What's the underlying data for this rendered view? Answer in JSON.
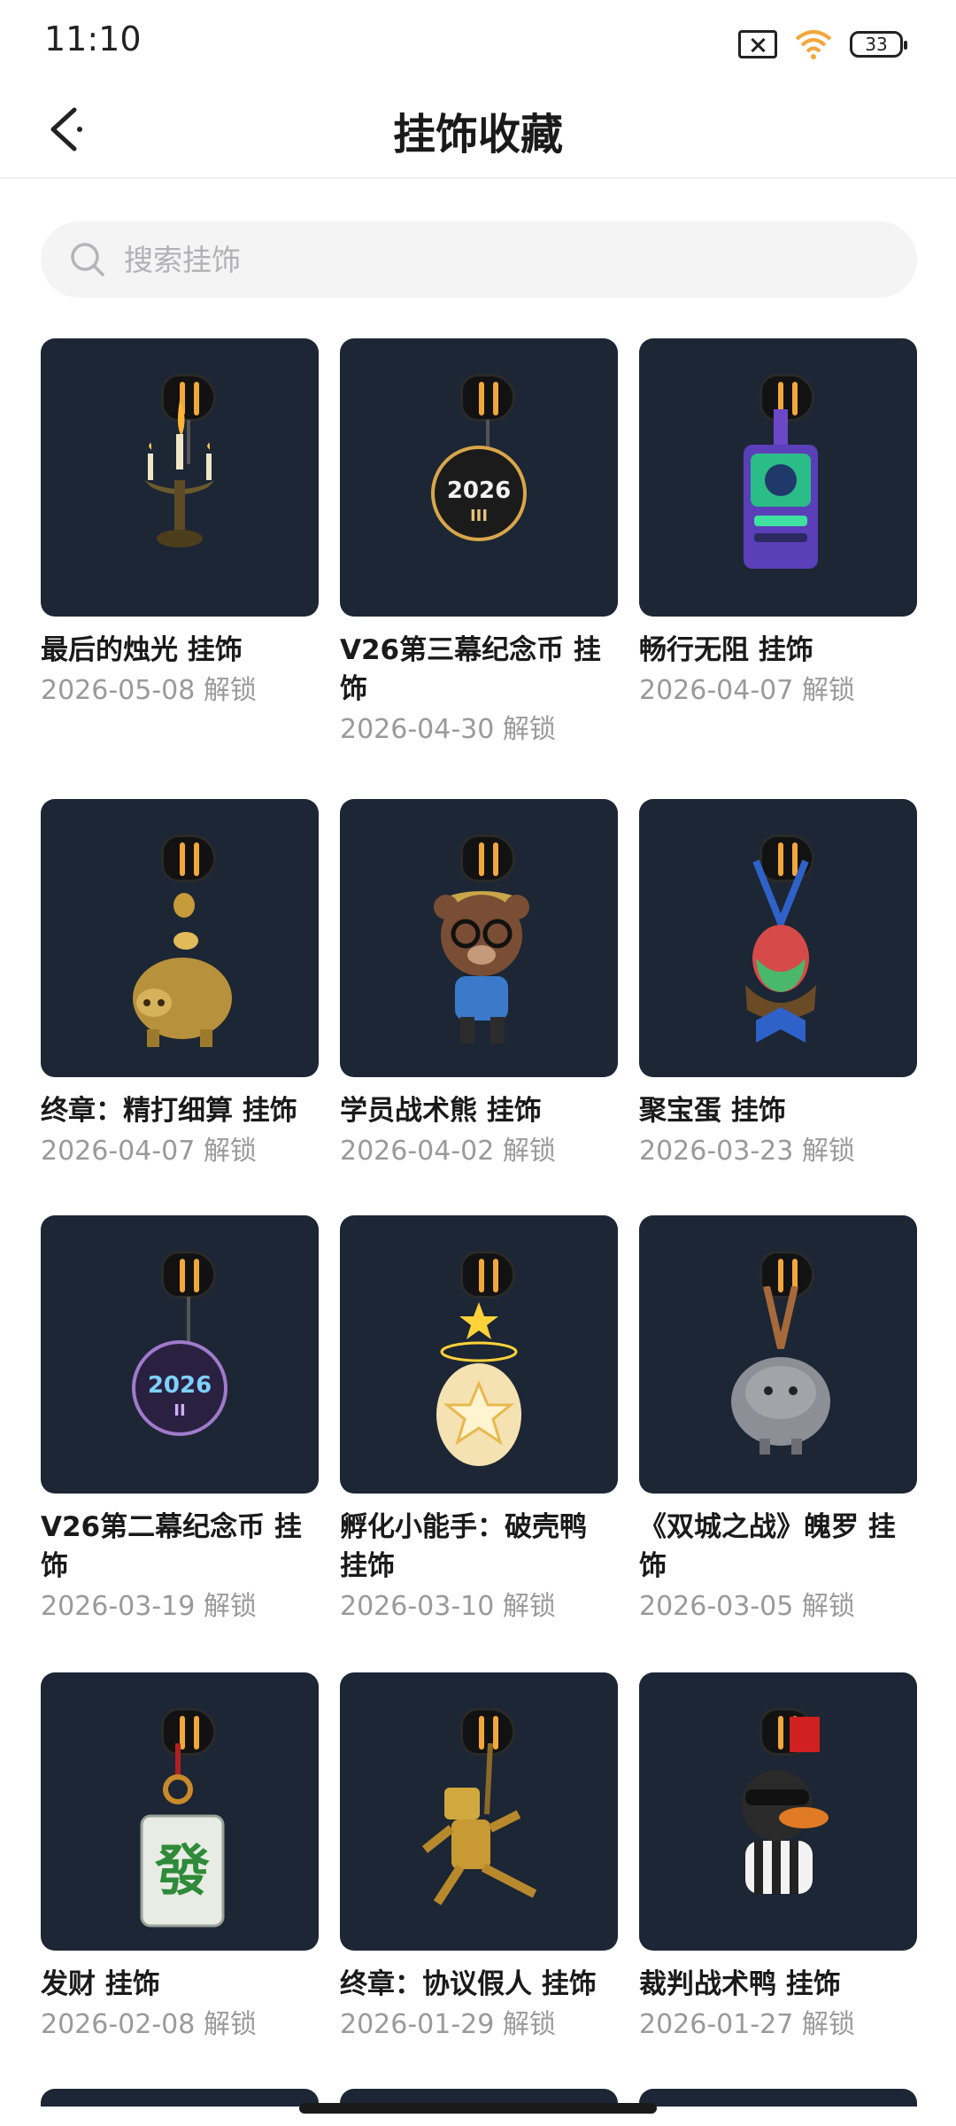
{
  "status_bar": {
    "time": "11:10",
    "battery": "33"
  },
  "header": {
    "title": "挂饰收藏"
  },
  "search": {
    "placeholder": "搜索挂饰",
    "value": ""
  },
  "items": [
    {
      "title": "最后的烛光 挂饰",
      "date": "2026-05-08 解锁",
      "icon": "candelabra-charm",
      "accent": "#c8a24a"
    },
    {
      "title": "V26第三幕纪念币 挂饰",
      "date": "2026-04-30 解锁",
      "icon": "coin-2026-iii-charm",
      "accent": "#1b1b1b"
    },
    {
      "title": "畅行无阻 挂饰",
      "date": "2026-04-07 解锁",
      "icon": "badge-card-charm",
      "accent": "#6a48c8"
    },
    {
      "title": "终章：精打细算 挂饰",
      "date": "2026-04-07 解锁",
      "icon": "golden-piggy-bank-charm",
      "accent": "#caa34a"
    },
    {
      "title": "学员战术熊 挂饰",
      "date": "2026-04-02 解锁",
      "icon": "bear-charm",
      "accent": "#8a5a3c"
    },
    {
      "title": "聚宝蛋 挂饰",
      "date": "2026-03-23 解锁",
      "icon": "egg-basket-charm",
      "accent": "#2e62c9"
    },
    {
      "title": "V26第二幕纪念币 挂饰",
      "date": "2026-03-19 解锁",
      "icon": "coin-2026-ii-charm",
      "accent": "#2a2140"
    },
    {
      "title": "孵化小能手：破壳鸭 挂饰",
      "date": "2026-03-10 解锁",
      "icon": "glowing-egg-charm",
      "accent": "#f2d58a"
    },
    {
      "title": "《双城之战》魄罗 挂饰",
      "date": "2026-03-05 解锁",
      "icon": "poro-charm",
      "accent": "#8d8f96"
    },
    {
      "title": "发财 挂饰",
      "date": "2026-02-08 解锁",
      "icon": "mahjong-tile-charm",
      "accent": "#e8ece4"
    },
    {
      "title": "终章：协议假人 挂饰",
      "date": "2026-01-29 解锁",
      "icon": "golden-robot-charm",
      "accent": "#d1a83d"
    },
    {
      "title": "裁判战术鸭 挂饰",
      "date": "2026-01-27 解锁",
      "icon": "referee-duck-charm",
      "accent": "#e07a24"
    }
  ]
}
